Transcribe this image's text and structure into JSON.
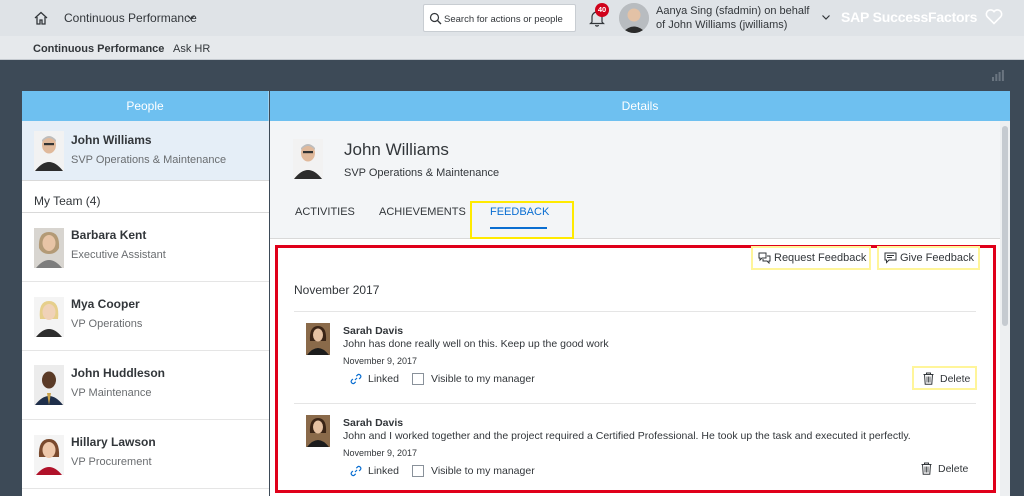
{
  "shell": {
    "app_title": "Continuous Performance",
    "search_placeholder": "Search for actions or people",
    "notification_count": "40",
    "user_line1": "Aanya Sing (sfadmin) on behalf",
    "user_line2": "of John Williams (jwilliams)",
    "brand": "SAP SuccessFactors"
  },
  "subnav": {
    "items": [
      "Continuous Performance",
      "Ask HR"
    ]
  },
  "people": {
    "header": "People",
    "me": {
      "name": "John Williams",
      "title": "SVP Operations & Maintenance"
    },
    "team_label": "My Team (4)",
    "team": [
      {
        "name": "Barbara Kent",
        "title": "Executive Assistant"
      },
      {
        "name": "Mya Cooper",
        "title": "VP Operations"
      },
      {
        "name": "John Huddleson",
        "title": "VP Maintenance"
      },
      {
        "name": "Hillary Lawson",
        "title": "VP Procurement"
      }
    ]
  },
  "details": {
    "header": "Details",
    "name": "John Williams",
    "title": "SVP Operations & Maintenance",
    "tabs": [
      "ACTIVITIES",
      "ACHIEVEMENTS",
      "FEEDBACK"
    ],
    "active_tab": "FEEDBACK"
  },
  "feedback": {
    "request_label": "Request Feedback",
    "give_label": "Give Feedback",
    "month": "November 2017",
    "items": [
      {
        "author": "Sarah Davis",
        "text": "John has done really well on this. Keep up the good work",
        "date": "November 9, 2017",
        "linked_label": "Linked",
        "visible_label": "Visible to my manager",
        "visible_checked": false,
        "delete_label": "Delete"
      },
      {
        "author": "Sarah Davis",
        "text": "John and I worked together and the project required a Certified Professional. He took up the task and executed it perfectly.",
        "date": "November 9, 2017",
        "linked_label": "Linked",
        "visible_label": "Visible to my manager",
        "visible_checked": false,
        "delete_label": "Delete"
      }
    ]
  },
  "colors": {
    "panel_header": "#6ec0f0",
    "annotation_red": "#e0001a",
    "annotation_yellow": "#ffea00",
    "badge_red": "#d0021b"
  }
}
